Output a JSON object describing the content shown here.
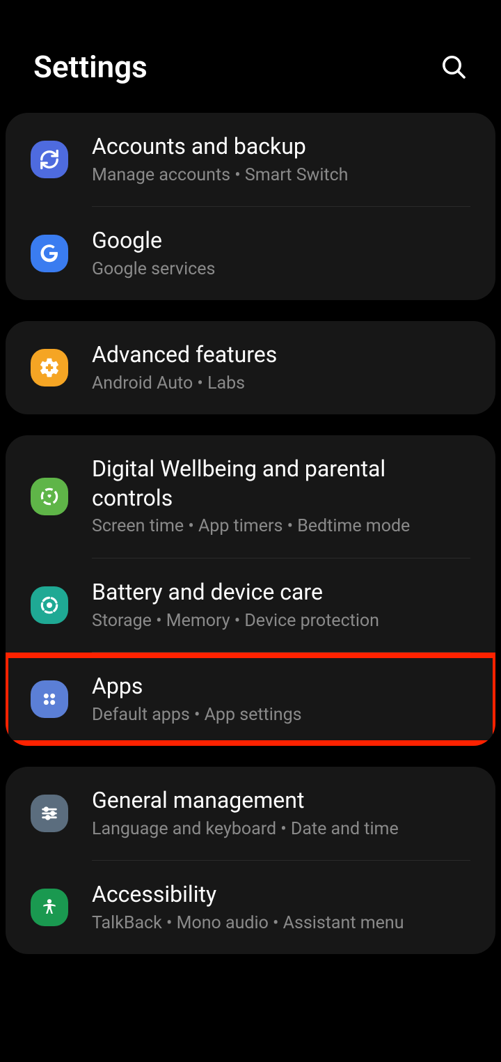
{
  "header": {
    "title": "Settings"
  },
  "groups": [
    {
      "items": [
        {
          "name": "accounts-backup",
          "title": "Accounts and backup",
          "subtitle": "Manage accounts  •  Smart Switch",
          "iconColor": "#4e6bdf",
          "icon": "sync"
        },
        {
          "name": "google",
          "title": "Google",
          "subtitle": "Google services",
          "iconColor": "#3a7cf0",
          "icon": "google"
        }
      ]
    },
    {
      "items": [
        {
          "name": "advanced-features",
          "title": "Advanced features",
          "subtitle": "Android Auto  •  Labs",
          "iconColor": "#f5a524",
          "icon": "gear-plus"
        }
      ]
    },
    {
      "items": [
        {
          "name": "digital-wellbeing",
          "title": "Digital Wellbeing and parental controls",
          "subtitle": "Screen time  •  App timers  •  Bedtime mode",
          "iconColor": "#5fb548",
          "icon": "wellbeing"
        },
        {
          "name": "battery-device-care",
          "title": "Battery and device care",
          "subtitle": "Storage  •  Memory  •  Device protection",
          "iconColor": "#1fa994",
          "icon": "device-care"
        },
        {
          "name": "apps",
          "title": "Apps",
          "subtitle": "Default apps  •  App settings",
          "iconColor": "#5b7fd6",
          "icon": "apps",
          "highlighted": true
        }
      ]
    },
    {
      "items": [
        {
          "name": "general-management",
          "title": "General management",
          "subtitle": "Language and keyboard  •  Date and time",
          "iconColor": "#5b6d7e",
          "icon": "sliders"
        },
        {
          "name": "accessibility",
          "title": "Accessibility",
          "subtitle": "TalkBack  •  Mono audio  •  Assistant menu",
          "iconColor": "#1a9950",
          "icon": "accessibility"
        }
      ]
    }
  ]
}
